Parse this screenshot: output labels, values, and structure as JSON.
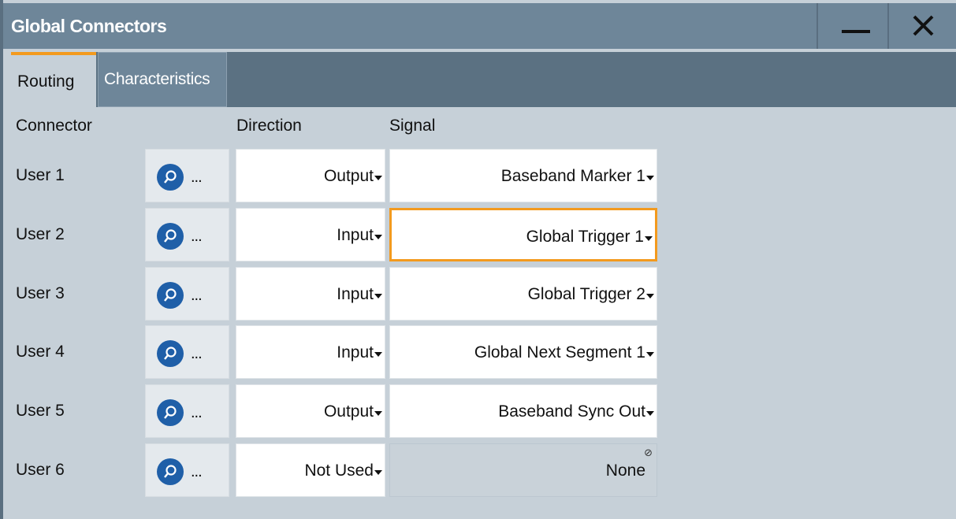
{
  "window": {
    "title": "Global Connectors"
  },
  "tabs": [
    {
      "label": "Routing",
      "active": true
    },
    {
      "label": "Characteristics",
      "active": false
    }
  ],
  "columns": {
    "connector": "Connector",
    "direction": "Direction",
    "signal": "Signal"
  },
  "search_button_ellipsis": "...",
  "rows": [
    {
      "connector": "User 1",
      "direction": "Output",
      "signal": "Baseband Marker 1"
    },
    {
      "connector": "User 2",
      "direction": "Input",
      "signal": "Global Trigger 1"
    },
    {
      "connector": "User 3",
      "direction": "Input",
      "signal": "Global Trigger 2"
    },
    {
      "connector": "User 4",
      "direction": "Input",
      "signal": "Global Next Segment 1"
    },
    {
      "connector": "User 5",
      "direction": "Output",
      "signal": "Baseband Sync Out"
    },
    {
      "connector": "User 6",
      "direction": "Not Used",
      "signal": "None"
    }
  ],
  "icons": {
    "minimize": "minimize-icon",
    "close": "close-icon",
    "search": "search-icon",
    "dropdown": "caret-down-icon",
    "disabled": "disabled-icon"
  },
  "colors": {
    "titlebar": "#6e8699",
    "tab_accent": "#f39a1e",
    "search_circle": "#1f5fa8",
    "focus_border": "#f39a1e"
  }
}
